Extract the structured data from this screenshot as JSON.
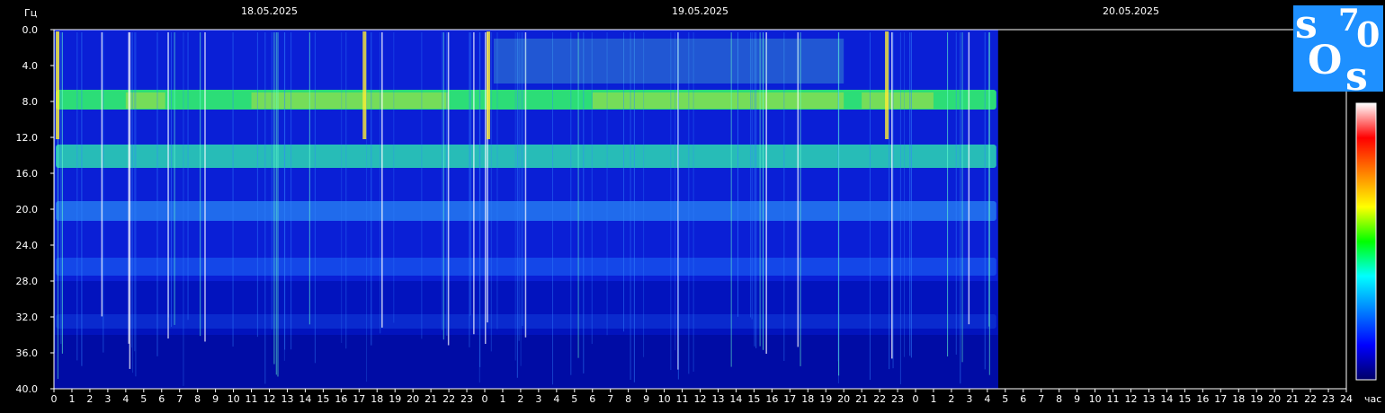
{
  "chart_data": {
    "type": "heatmap",
    "title": "",
    "ylabel": "Гц",
    "xlabel": "час",
    "ylim": [
      0,
      40
    ],
    "y_ticks": [
      "0.0",
      "4.0",
      "8.0",
      "12.0",
      "16.0",
      "20.0",
      "24.0",
      "28.0",
      "32.0",
      "36.0",
      "40.0"
    ],
    "dates": [
      "18.05.2025",
      "19.05.2025",
      "20.05.2025"
    ],
    "x_ticks": [
      "0",
      "1",
      "2",
      "3",
      "4",
      "5",
      "6",
      "7",
      "8",
      "9",
      "10",
      "11",
      "12",
      "13",
      "14",
      "15",
      "16",
      "17",
      "18",
      "19",
      "20",
      "21",
      "22",
      "23",
      "0",
      "1",
      "2",
      "3",
      "4",
      "5",
      "6",
      "7",
      "8",
      "9",
      "10",
      "11",
      "12",
      "13",
      "14",
      "15",
      "16",
      "17",
      "18",
      "19",
      "20",
      "21",
      "22",
      "23",
      "0",
      "1",
      "2",
      "3",
      "4",
      "5",
      "6",
      "7",
      "8",
      "9",
      "10",
      "11",
      "12",
      "13",
      "14",
      "15",
      "16",
      "17",
      "18",
      "19",
      "20",
      "21",
      "22",
      "23",
      "24"
    ],
    "x_range_hours": [
      0,
      72
    ],
    "data_end_hours": 52.6,
    "resonance_bands_hz": [
      7.8,
      14.1,
      20.2,
      26.4,
      32.5
    ],
    "grid": false,
    "colorbar": "right",
    "colormap": [
      "#000066",
      "#0000ff",
      "#0080ff",
      "#00ffff",
      "#00ff00",
      "#ffff00",
      "#ff8000",
      "#ff0000",
      "#ffffff"
    ]
  },
  "logo": {
    "letters": [
      "s",
      "7",
      "0",
      "O",
      "s"
    ],
    "bg_color": "#1e90ff"
  }
}
